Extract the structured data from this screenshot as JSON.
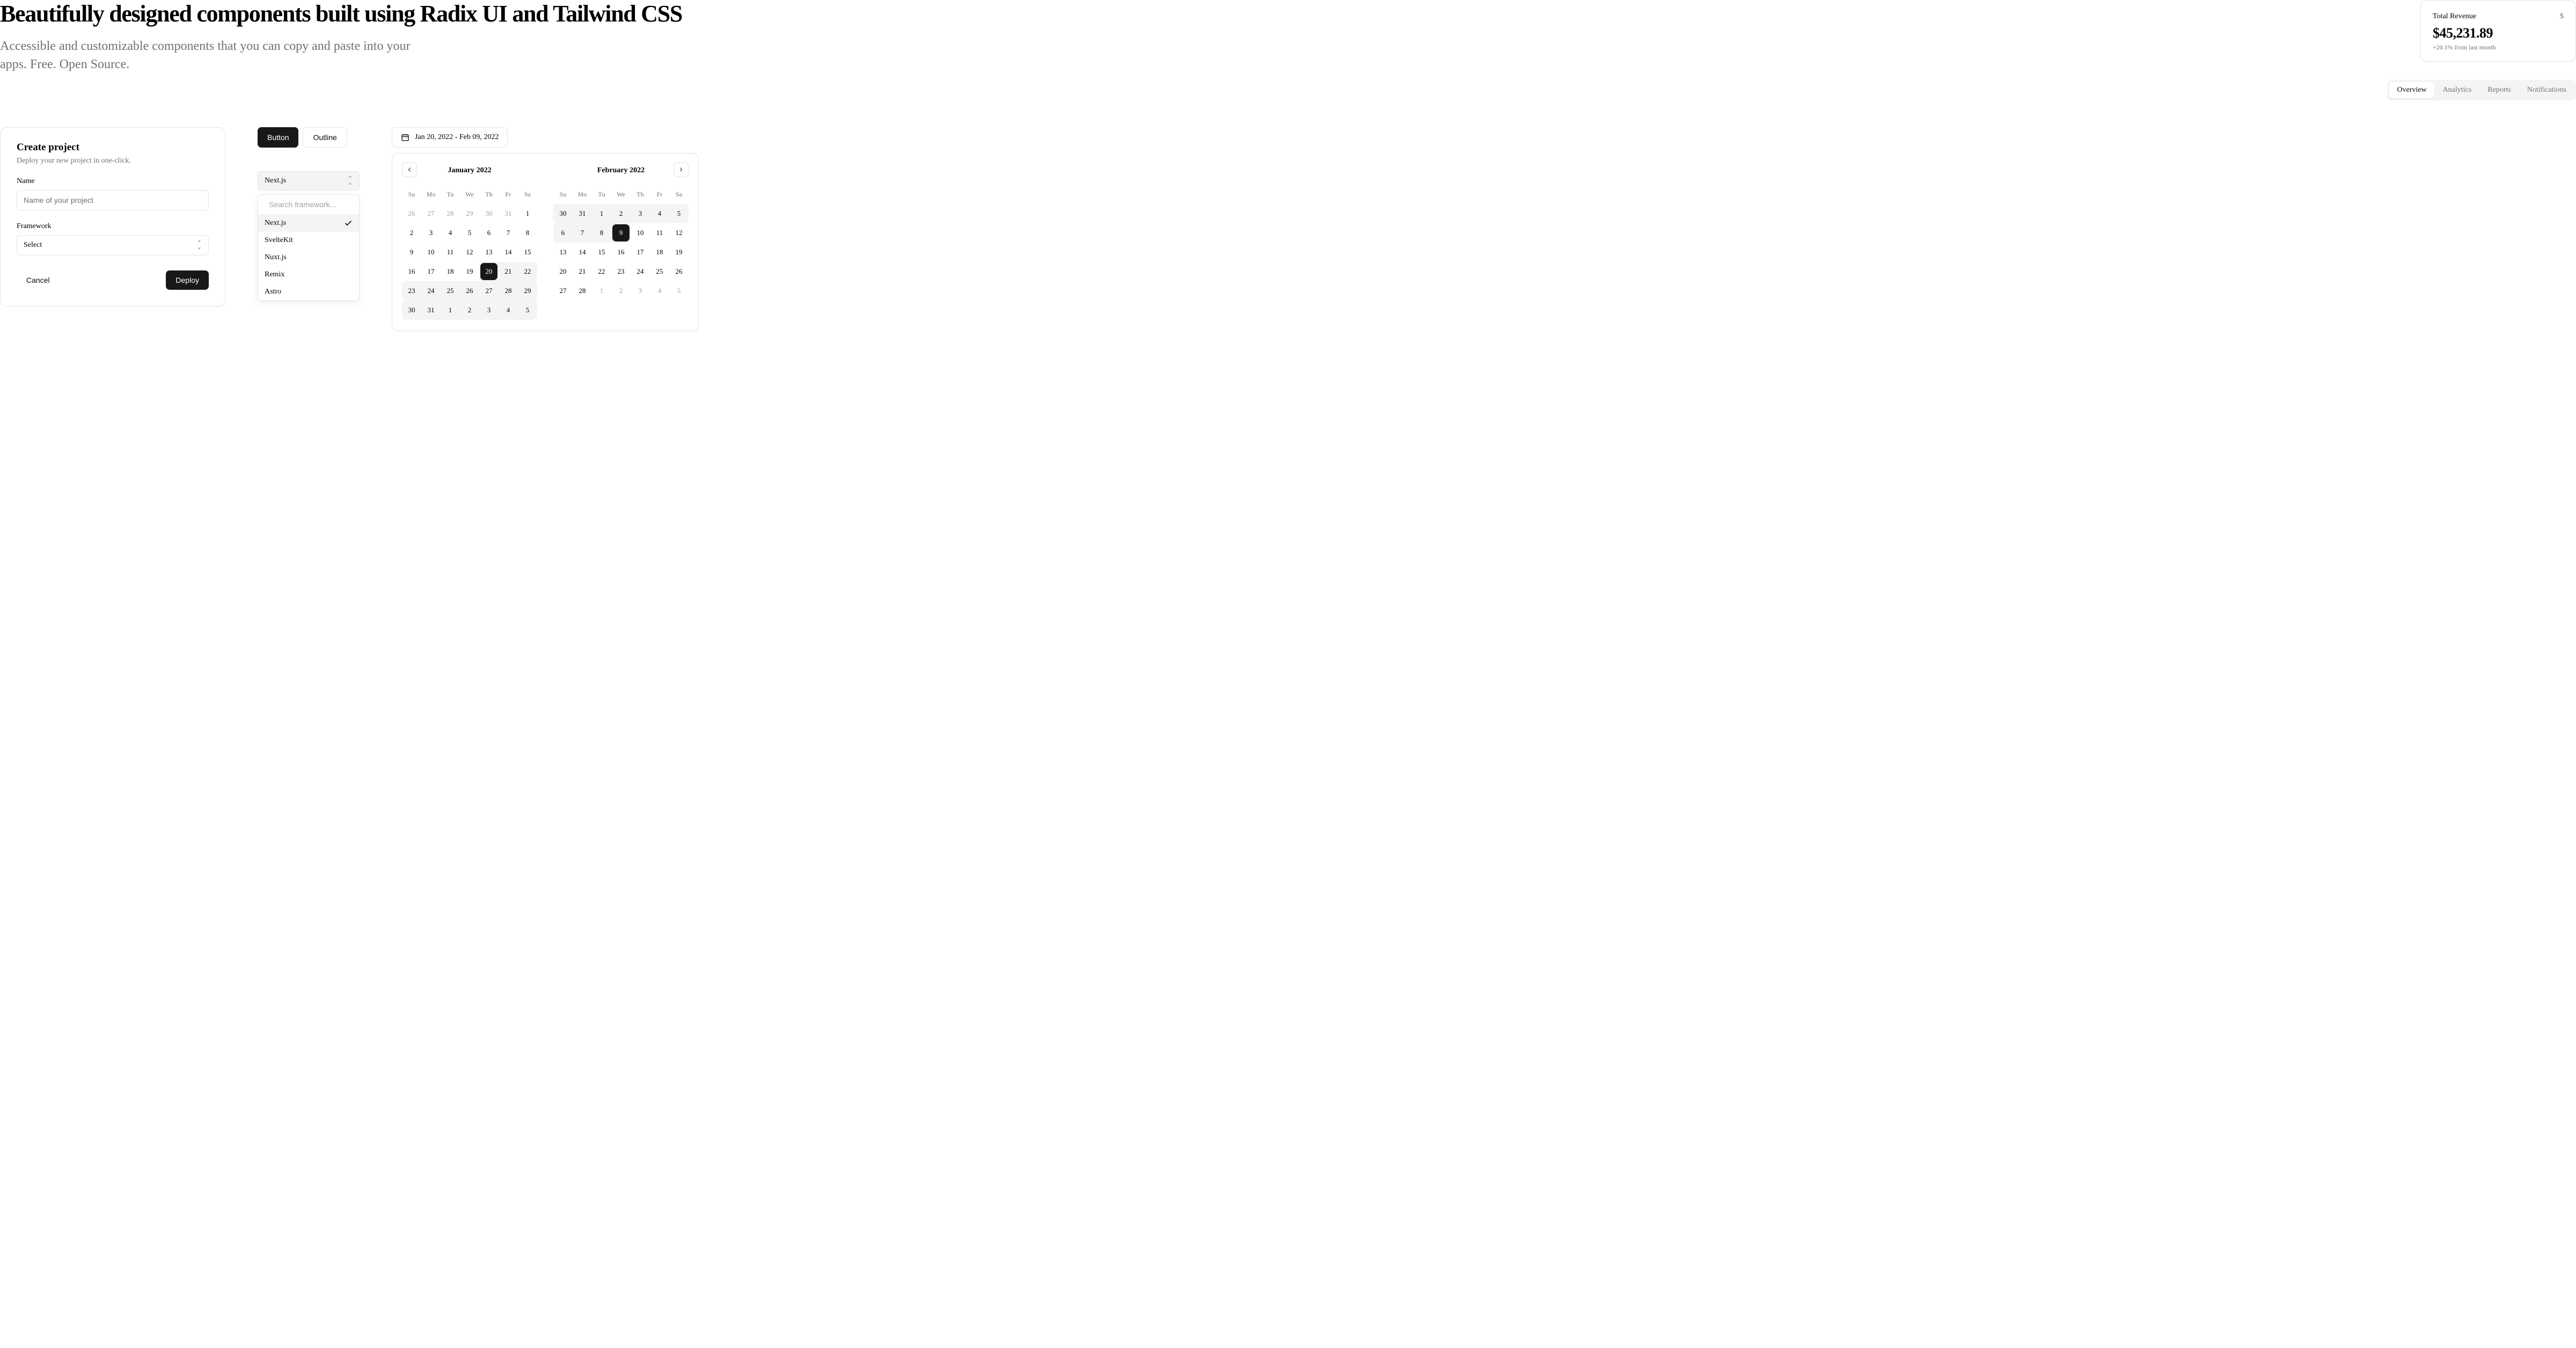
{
  "heading": "Beautifully designed components built using Radix UI and Tailwind CSS",
  "subheading": "Accessible and customizable components that you can copy and paste into your apps. Free. Open Source.",
  "revenue": {
    "label": "Total Revenue",
    "value": "$45,231.89",
    "delta": "+20.1% from last month"
  },
  "tabs": [
    "Overview",
    "Analytics",
    "Reports",
    "Notifications"
  ],
  "create": {
    "title": "Create project",
    "desc": "Deploy your new project in one-click.",
    "name_label": "Name",
    "name_placeholder": "Name of your project",
    "fw_label": "Framework",
    "fw_value": "Select",
    "cancel": "Cancel",
    "deploy": "Deploy"
  },
  "buttons": {
    "primary": "Button",
    "outline": "Outline"
  },
  "combo": {
    "value": "Next.js",
    "search_placeholder": "Search framework...",
    "items": [
      "Next.js",
      "SvelteKit",
      "Nuxt.js",
      "Remix",
      "Astro"
    ]
  },
  "date": {
    "text": "Jan 20, 2022 - Feb 09, 2022"
  },
  "cal": {
    "dow": [
      "Su",
      "Mo",
      "Tu",
      "We",
      "Th",
      "Fr",
      "Sa"
    ],
    "months": [
      {
        "name": "January 2022",
        "days": [
          {
            "n": 26,
            "out": 1
          },
          {
            "n": 27,
            "out": 1
          },
          {
            "n": 28,
            "out": 1
          },
          {
            "n": 29,
            "out": 1
          },
          {
            "n": 30,
            "out": 1
          },
          {
            "n": 31,
            "out": 1
          },
          {
            "n": 1
          },
          {
            "n": 2
          },
          {
            "n": 3
          },
          {
            "n": 4
          },
          {
            "n": 5
          },
          {
            "n": 6
          },
          {
            "n": 7
          },
          {
            "n": 8
          },
          {
            "n": 9
          },
          {
            "n": 10
          },
          {
            "n": 11
          },
          {
            "n": 12
          },
          {
            "n": 13
          },
          {
            "n": 14
          },
          {
            "n": 15
          },
          {
            "n": 16
          },
          {
            "n": 17
          },
          {
            "n": 18
          },
          {
            "n": 19
          },
          {
            "n": 20,
            "sel": 1,
            "r": 1,
            "f": 1
          },
          {
            "n": 21,
            "r": 1
          },
          {
            "n": 22,
            "r": 1,
            "l": 1
          },
          {
            "n": 23,
            "r": 1,
            "f": 1
          },
          {
            "n": 24,
            "r": 1
          },
          {
            "n": 25,
            "r": 1
          },
          {
            "n": 26,
            "r": 1
          },
          {
            "n": 27,
            "r": 1
          },
          {
            "n": 28,
            "r": 1
          },
          {
            "n": 29,
            "r": 1,
            "l": 1
          },
          {
            "n": 30,
            "r": 1,
            "f": 1
          },
          {
            "n": 31,
            "r": 1
          },
          {
            "n": 1,
            "r": 1
          },
          {
            "n": 2,
            "r": 1
          },
          {
            "n": 3,
            "r": 1
          },
          {
            "n": 4,
            "r": 1
          },
          {
            "n": 5,
            "r": 1,
            "l": 1
          }
        ]
      },
      {
        "name": "February 2022",
        "days": [
          {
            "n": 30,
            "r": 1,
            "f": 1
          },
          {
            "n": 31,
            "r": 1
          },
          {
            "n": 1,
            "r": 1
          },
          {
            "n": 2,
            "r": 1
          },
          {
            "n": 3,
            "r": 1
          },
          {
            "n": 4,
            "r": 1
          },
          {
            "n": 5,
            "r": 1,
            "l": 1
          },
          {
            "n": 6,
            "r": 1,
            "f": 1
          },
          {
            "n": 7,
            "r": 1
          },
          {
            "n": 8,
            "r": 1
          },
          {
            "n": 9,
            "sel": 1,
            "r": 1,
            "l": 1
          },
          {
            "n": 10
          },
          {
            "n": 11
          },
          {
            "n": 12
          },
          {
            "n": 13
          },
          {
            "n": 14
          },
          {
            "n": 15
          },
          {
            "n": 16
          },
          {
            "n": 17
          },
          {
            "n": 18
          },
          {
            "n": 19
          },
          {
            "n": 20
          },
          {
            "n": 21
          },
          {
            "n": 22
          },
          {
            "n": 23
          },
          {
            "n": 24
          },
          {
            "n": 25
          },
          {
            "n": 26
          },
          {
            "n": 27
          },
          {
            "n": 28
          },
          {
            "n": 1,
            "out": 1
          },
          {
            "n": 2,
            "out": 1
          },
          {
            "n": 3,
            "out": 1
          },
          {
            "n": 4,
            "out": 1
          },
          {
            "n": 5,
            "out": 1
          }
        ]
      }
    ]
  }
}
